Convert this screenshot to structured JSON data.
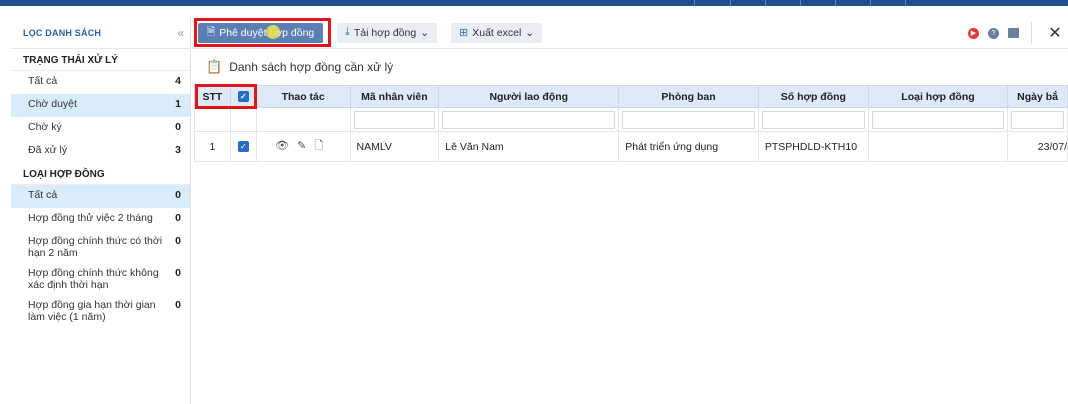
{
  "sidebar": {
    "title": "LỌC DANH SÁCH",
    "status_section": "TRẠNG THÁI XỬ LÝ",
    "status_items": [
      {
        "label": "Tất cả",
        "count": "4"
      },
      {
        "label": "Chờ duyệt",
        "count": "1"
      },
      {
        "label": "Chờ ký",
        "count": "0"
      },
      {
        "label": "Đã xử lý",
        "count": "3"
      }
    ],
    "type_section": "LOẠI HỢP ĐỒNG",
    "type_items": [
      {
        "label": "Tất cả",
        "count": "0"
      },
      {
        "label": "Hợp đồng thử việc 2 tháng",
        "count": "0"
      },
      {
        "label": "Hợp đồng chính thức có thời hạn 2 năm",
        "count": "0"
      },
      {
        "label": "Hợp đồng chính thức không xác định thời hạn",
        "count": "0"
      },
      {
        "label": "Hợp đồng gia hạn thời gian làm việc (1 năm)",
        "count": "0"
      }
    ]
  },
  "toolbar": {
    "approve_label": "Phê duyệt hợp đồng",
    "download_label": "Tải hợp đồng",
    "export_label": "Xuất excel"
  },
  "list": {
    "title": "Danh sách hợp đồng cần xử lý",
    "columns": [
      "STT",
      "",
      "Thao tác",
      "Mã nhân viên",
      "Người lao động",
      "Phòng ban",
      "Số hợp đồng",
      "Loại hợp đồng",
      "Ngày bắ"
    ],
    "rows": [
      {
        "stt": "1",
        "code": "NAMLV",
        "name": "Lê Văn Nam",
        "dept": "Phát triển ứng dụng",
        "contract_no": "PTSPHDLD-KTH10",
        "type": "",
        "date": "23/07/"
      }
    ]
  },
  "colors": {
    "primary": "#5b7fb3",
    "highlight": "#e3151a",
    "active_bg": "#d9ecfb",
    "header_bg": "#dde9f7"
  }
}
